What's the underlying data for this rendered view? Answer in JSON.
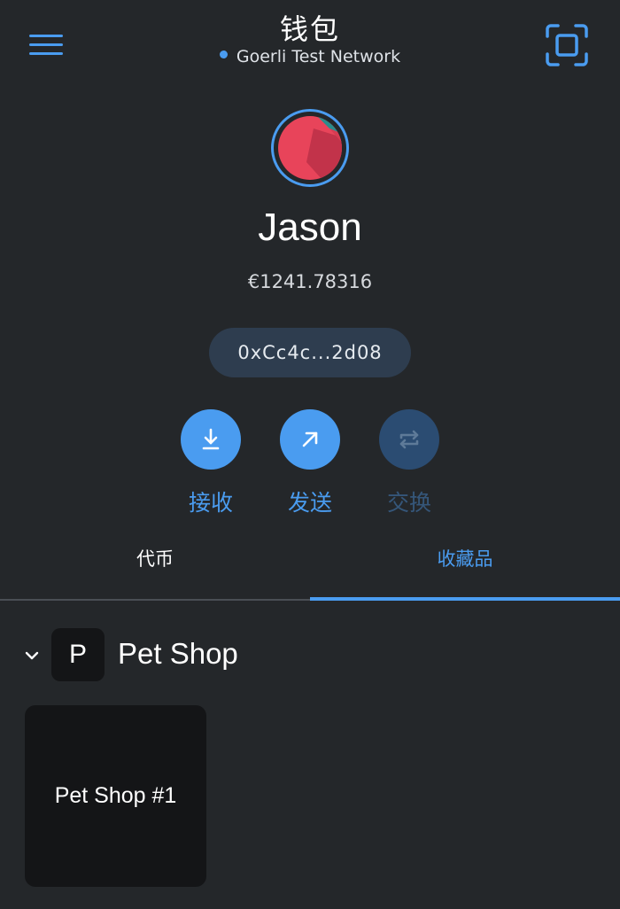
{
  "header": {
    "title": "钱包",
    "network": "Goerli Test Network",
    "icons": {
      "menu": "hamburger-menu-icon",
      "scan": "qr-scan-icon"
    }
  },
  "account": {
    "name": "Jason",
    "balance": "€1241.78316",
    "address": "0xCc4c...2d08"
  },
  "actions": [
    {
      "label": "接收",
      "icon": "receive-download-icon",
      "enabled": true
    },
    {
      "label": "发送",
      "icon": "send-arrow-icon",
      "enabled": true
    },
    {
      "label": "交换",
      "icon": "swap-icon",
      "enabled": false
    }
  ],
  "tabs": [
    {
      "label": "代币",
      "active": false
    },
    {
      "label": "收藏品",
      "active": true
    }
  ],
  "collection": {
    "icon_letter": "P",
    "name": "Pet Shop",
    "items": [
      {
        "label": "Pet Shop #1"
      }
    ]
  },
  "colors": {
    "background": "#24272a",
    "accent": "#4a9cf0",
    "address_pill": "#2e3d4f",
    "card": "#141517",
    "disabled_action": "#2b4c72"
  }
}
